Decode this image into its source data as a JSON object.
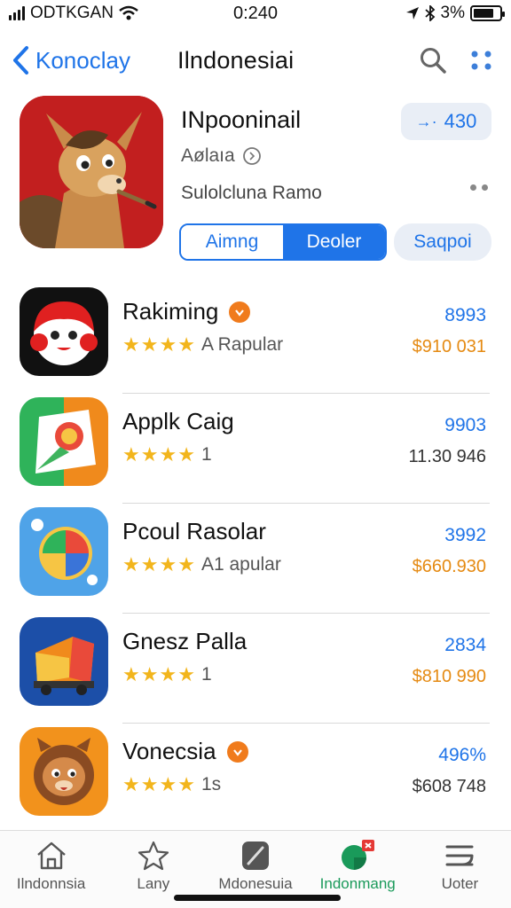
{
  "status": {
    "carrier": "ODTKGAN",
    "time": "0:240",
    "battery": "3%"
  },
  "navbar": {
    "back_label": "Konoclay",
    "title": "Ilndonesiai"
  },
  "featured": {
    "name": "INpooninail",
    "subtitle": "Aølaıa",
    "developer": "Sulolcluna Ramo",
    "price_label": "430",
    "segment_a": "Aimng",
    "segment_b": "Deoler",
    "action_label": "Saqpoi"
  },
  "apps": [
    {
      "name": "Rakiming",
      "rating_text": "A Rapular",
      "value1": "8993",
      "value2": "$910 031",
      "value2_color": "#e58a12",
      "badge": true,
      "stars": 3.5
    },
    {
      "name": "Applk Caig",
      "rating_text": "1",
      "value1": "9903",
      "value2": "11.30 946",
      "value2_color": "#333333",
      "badge": false,
      "stars": 3.5
    },
    {
      "name": "Pcoul Rasolar",
      "rating_text": "A1 apular",
      "value1": "3992",
      "value2": "$660.930",
      "value2_color": "#e58a12",
      "badge": false,
      "stars": 3.5
    },
    {
      "name": "Gnesz Palla",
      "rating_text": "1",
      "value1": "2834",
      "value2": "$810 990",
      "value2_color": "#e58a12",
      "badge": false,
      "stars": 3.5
    },
    {
      "name": "Vonecsia",
      "rating_text": "1s",
      "value1": "496%",
      "value2": "$608 748",
      "value2_color": "#333333",
      "badge": true,
      "stars": 3.5
    }
  ],
  "tabs": [
    {
      "label": "Ilndonnsia",
      "icon": "home-icon"
    },
    {
      "label": "Lany",
      "icon": "star-icon"
    },
    {
      "label": "Mdonesuia",
      "icon": "gallery-icon"
    },
    {
      "label": "Indonmang",
      "icon": "apps-icon"
    },
    {
      "label": "Uoter",
      "icon": "updates-icon"
    }
  ],
  "colors": {
    "accent": "#1f74e8",
    "price_orange": "#e58a12",
    "star": "#f2b51c",
    "active_tab": "#1a9a5a"
  }
}
